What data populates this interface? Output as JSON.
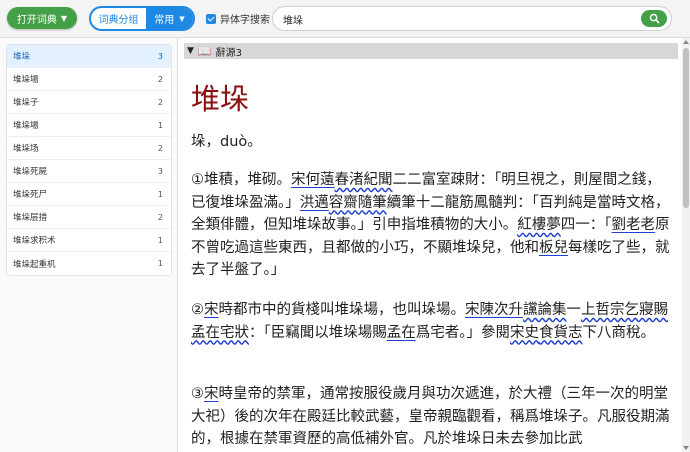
{
  "toolbar": {
    "open_label": "打开词典",
    "seg_group_label": "词典分组",
    "seg_common_label": "常用",
    "variant_label": "异体字搜索",
    "variant_checked": true,
    "search_value": "堆垛",
    "accent_color": "#1e88e5",
    "green_color": "#43a047"
  },
  "sidebar": {
    "items": [
      {
        "label": "堆垛",
        "count": "3"
      },
      {
        "label": "堆垛場",
        "count": "2"
      },
      {
        "label": "堆垛子",
        "count": "2"
      },
      {
        "label": "堆垛場",
        "count": "1"
      },
      {
        "label": "堆垛场",
        "count": "2"
      },
      {
        "label": "堆垛死屍",
        "count": "3"
      },
      {
        "label": "堆垛死尸",
        "count": "1"
      },
      {
        "label": "堆垛层措",
        "count": "2"
      },
      {
        "label": "堆垛求积术",
        "count": "1"
      },
      {
        "label": "堆垛起重机",
        "count": "1"
      }
    ]
  },
  "entry": {
    "dict_name": "辭源3",
    "headword": "堆垛",
    "pronunciation": "垛，duò。",
    "def1": {
      "lead": "①堆積，堆砌。",
      "p1": "宋",
      "p2": "何薳",
      "p3": "春渚紀聞",
      "p4": "二二富室疎財：「明旦視之，則屋間之錢，已復堆垛盈滿。」",
      "p5": "洪邁",
      "p6": "容齋隨筆",
      "p7": "續筆十二龍筋鳳髓判：「百判純是當時文格，全類俳體，但知堆垛故事。」引申指堆積物的大小。",
      "p8": "紅樓夢",
      "p9": "四一：「",
      "p10": "劉老老",
      "p11": "原不曾吃過這些東西，且都做的小巧，不顯堆垛兒，他和",
      "p12": "板兒",
      "p13": "每樣吃了些，就去了半盤了。」"
    },
    "def2": {
      "lead": "②",
      "p1": "宋",
      "p2": "時都市中的貨棧叫堆垛場，也叫垛場。",
      "p3": "宋",
      "p4": "陳次升",
      "p5": "讜論集",
      "p6": "一",
      "p7": "上哲宗乞寢賜孟在宅狀",
      "p8": "：「臣竊聞以堆垛場賜",
      "p9": "孟在",
      "p10": "爲宅者。」參閱",
      "p11": "宋史",
      "p12": "食貨志",
      "p13": "下八商稅。"
    },
    "def3": {
      "lead": "③",
      "p1": "宋",
      "p2": "時皇帝的禁軍，通常按服役歲月與功次遞進，於大禮（三年一次的明堂大祀）後的次年在殿廷比較武藝，皇帝親臨觀看，稱爲堆垛子。凡服役期滿的，根據在禁軍資歷的高低補外官。凡於堆垛日未去參加比武"
    }
  }
}
